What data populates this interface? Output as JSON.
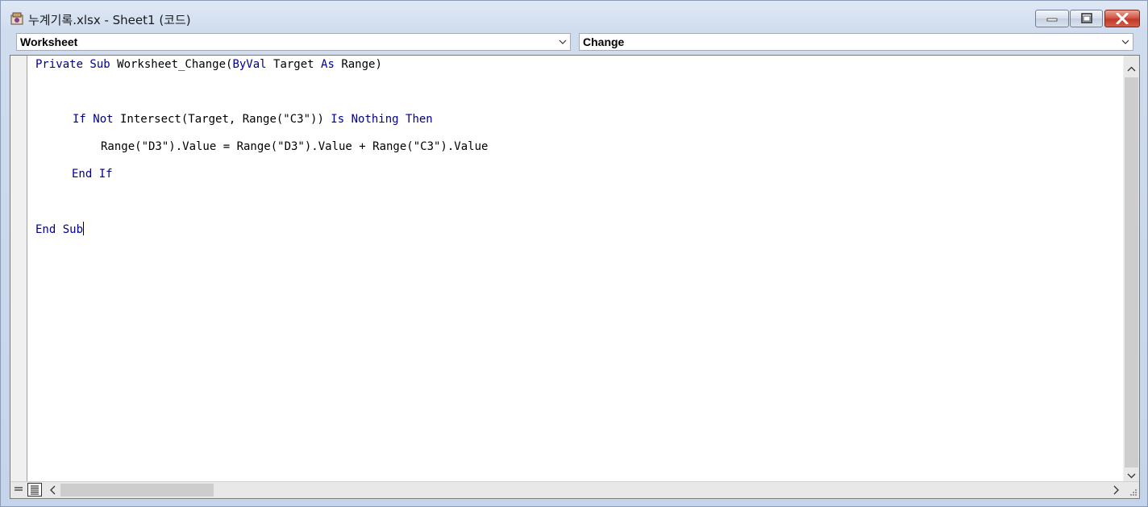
{
  "window": {
    "title": "누계기록.xlsx - Sheet1 (코드)",
    "icons": {
      "app": "vba-module-icon",
      "minimize": "minimize-icon",
      "maximize": "maximize-icon",
      "close": "close-icon"
    }
  },
  "object_combo": {
    "value": "Worksheet"
  },
  "procedure_combo": {
    "value": "Change"
  },
  "code": {
    "line1": {
      "kw1": "Private Sub",
      "text": " Worksheet_Change(",
      "kw2": "ByVal",
      "text2": " Target ",
      "kw3": "As",
      "text3": " Range)"
    },
    "line2": {
      "kw1": "If Not",
      "text": " Intersect(Target, Range(\"C3\")) ",
      "kw2": "Is Nothing Then"
    },
    "line3": {
      "text": "Range(\"D3\").Value = Range(\"D3\").Value + Range(\"C3\").Value"
    },
    "line4": {
      "kw1": "End If"
    },
    "line5": {
      "kw1": "End Sub"
    }
  },
  "colors": {
    "keyword": "#00008b",
    "close_button": "#c13a28"
  }
}
